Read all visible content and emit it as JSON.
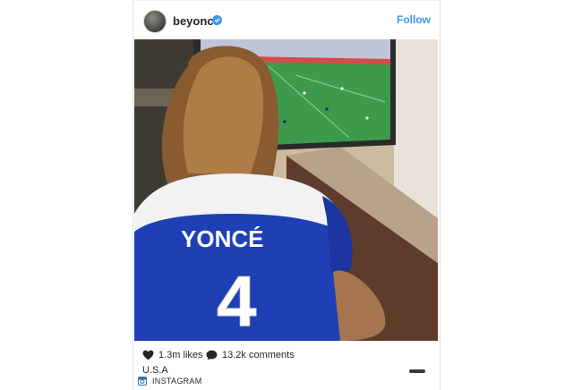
{
  "post": {
    "username": "beyonce",
    "follow_label": "Follow",
    "jersey_name": "YONCÉ",
    "jersey_number": "4",
    "likes": "1.3m likes",
    "comments": "13.2k comments",
    "caption": "U.S.A"
  },
  "brand": {
    "label": "INSTAGRAM"
  },
  "icons": {
    "verified": "verified-badge-icon",
    "like": "heart-icon",
    "comment": "comment-bubble-icon",
    "more": "more-options-icon",
    "brand": "instagram-logo-icon"
  },
  "colors": {
    "accent": "#3897f0",
    "text": "#262626",
    "jersey_blue": "#1f3fb4"
  }
}
